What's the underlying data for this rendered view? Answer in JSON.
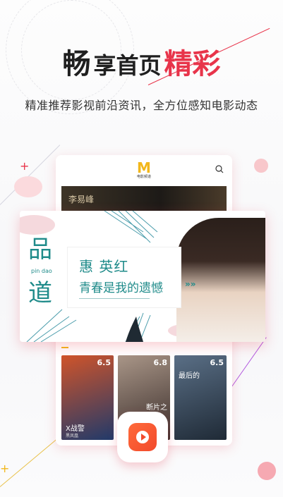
{
  "headline": {
    "part1": "畅",
    "part2": "享首页",
    "part3": "精彩"
  },
  "subtitle": "精准推荐影视前沿资讯，全方位感知电影动态",
  "app": {
    "logo_text": "电影频道",
    "logo_mark": "M"
  },
  "strip_text": "李易峰",
  "banner": {
    "pin_char1": "品",
    "pin_char2": "道",
    "pin_en": "pin dao",
    "guest_name": "惠 英红",
    "tagline": "青春是我的遗憾",
    "arrows": "»»"
  },
  "posters": [
    {
      "rating": "6.5",
      "title": "X战警",
      "subtitle": "黑凤凰",
      "color1": "#d0542a",
      "color2": "#213a6a"
    },
    {
      "rating": "6.8",
      "title": "断片之",
      "subtitle": "",
      "color1": "#a99688",
      "color2": "#3a2d2a"
    },
    {
      "rating": "6.5",
      "title": "最后的",
      "subtitle": "",
      "color1": "#5a6f86",
      "color2": "#1f2a36"
    }
  ],
  "colors": {
    "accent": "#e8344a",
    "teal": "#1f8b8a",
    "gold": "#f2b71b",
    "play": "#f24a2c"
  },
  "icons": {
    "search": "search-icon",
    "play": "play-icon",
    "arrow": "double-arrow-icon"
  }
}
